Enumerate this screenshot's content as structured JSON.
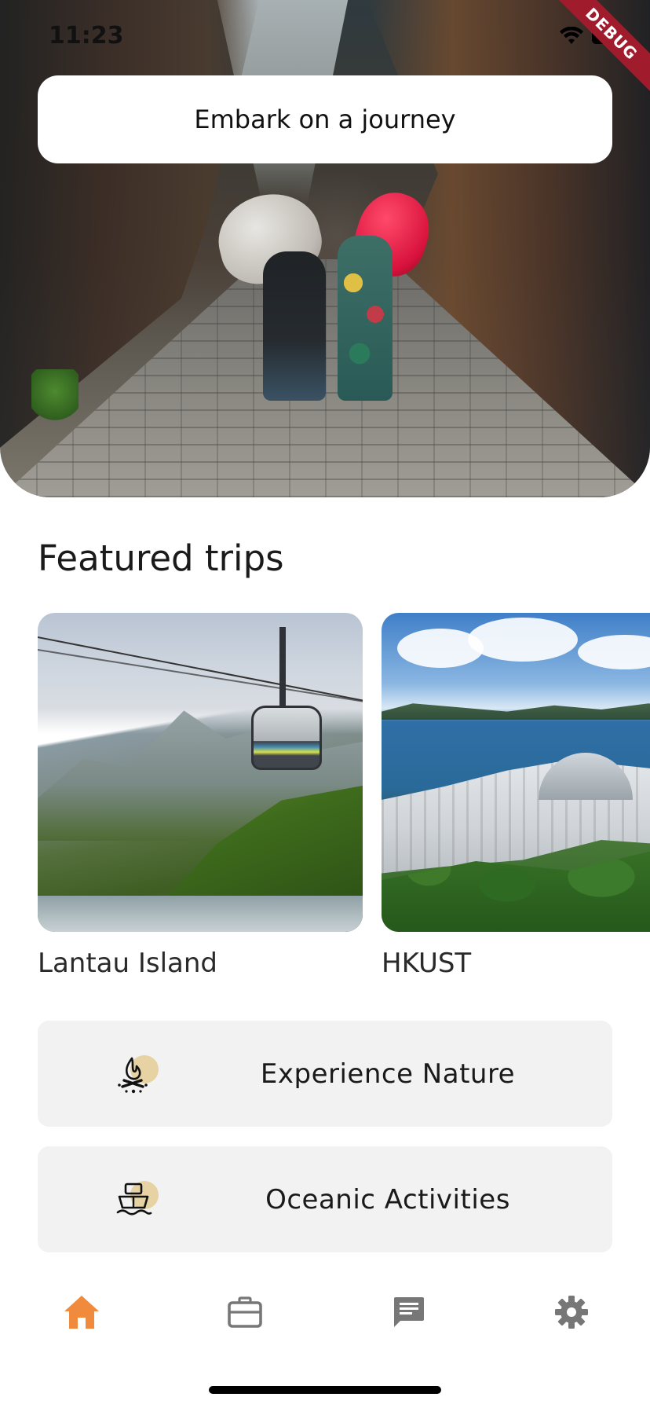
{
  "status_bar": {
    "time": "11:23"
  },
  "debug_banner": "DEBUG",
  "hero": {
    "title": "Embark on a journey"
  },
  "featured": {
    "heading": "Featured trips",
    "trips": [
      {
        "label": "Lantau Island"
      },
      {
        "label": "HKUST"
      }
    ]
  },
  "categories": [
    {
      "label": "Experience Nature",
      "icon": "campfire-icon"
    },
    {
      "label": "Oceanic Activities",
      "icon": "ship-icon"
    }
  ],
  "bottom_nav": {
    "items": [
      {
        "name": "home",
        "icon": "home-icon",
        "active": true
      },
      {
        "name": "trips",
        "icon": "briefcase-icon",
        "active": false
      },
      {
        "name": "messages",
        "icon": "chat-icon",
        "active": false
      },
      {
        "name": "settings",
        "icon": "gear-icon",
        "active": false
      }
    ]
  },
  "colors": {
    "accent": "#F08A3C",
    "inactive_icon": "#777777",
    "card_background": "#F2F2F2",
    "icon_highlight": "#E6D2A3",
    "debug_ribbon": "#A01B2C"
  }
}
